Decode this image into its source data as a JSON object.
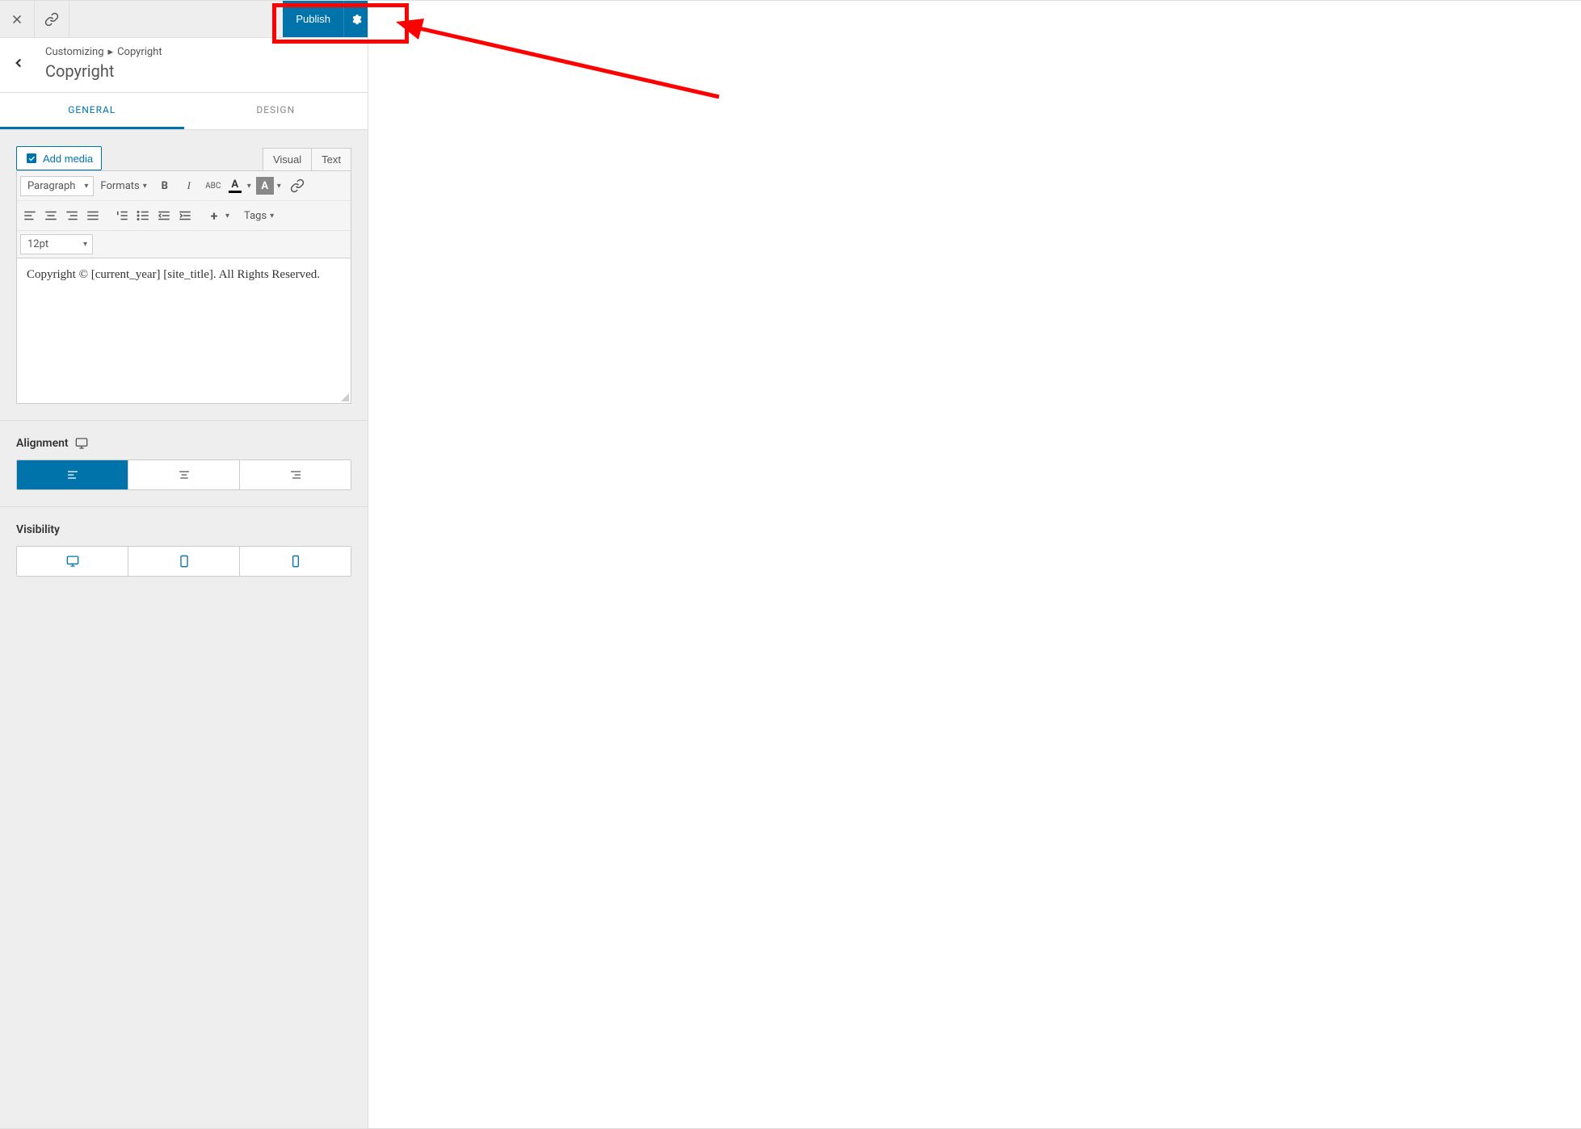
{
  "header": {
    "publish_label": "Publish"
  },
  "breadcrumb": {
    "root": "Customizing",
    "leaf": "Copyright",
    "title": "Copyright"
  },
  "tabs": {
    "general": "GENERAL",
    "design": "DESIGN"
  },
  "editor": {
    "add_media_label": "Add media",
    "mode_visual": "Visual",
    "mode_text": "Text",
    "paragraph_select": "Paragraph",
    "formats_select": "Formats",
    "tags_select": "Tags",
    "fontsize_select": "12pt",
    "content": "Copyright © [current_year] [site_title]. All Rights Reserved."
  },
  "alignment": {
    "label": "Alignment"
  },
  "visibility": {
    "label": "Visibility"
  }
}
